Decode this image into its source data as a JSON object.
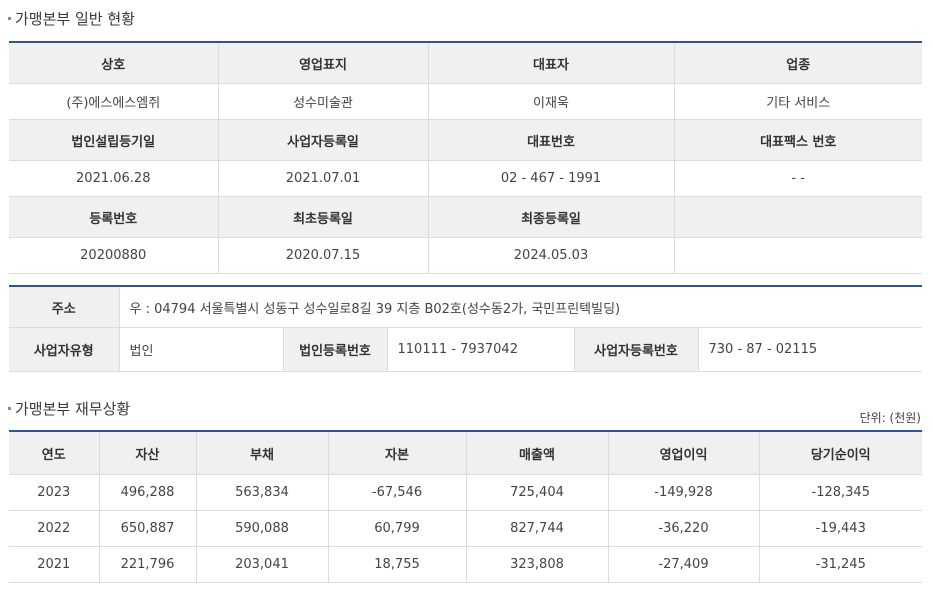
{
  "section1": {
    "title": "가맹본부 일반 현황",
    "rows": [
      {
        "headers": [
          "상호",
          "영업표지",
          "대표자",
          "업종"
        ],
        "values": [
          "(주)에스에스엠쥐",
          "성수미술관",
          "이재욱",
          "기타 서비스"
        ]
      },
      {
        "headers": [
          "법인설립등기일",
          "사업자등록일",
          "대표번호",
          "대표팩스 번호"
        ],
        "values": [
          "2021.06.28",
          "2021.07.01",
          "02 - 467 - 1991",
          "-   -"
        ]
      },
      {
        "headers": [
          "등록번호",
          "최초등록일",
          "최종등록일",
          ""
        ],
        "values": [
          "20200880",
          "2020.07.15",
          "2024.05.03",
          ""
        ]
      }
    ]
  },
  "address_block": {
    "address_label": "주소",
    "address_value": "우 : 04794 서울특별시 성동구 성수일로8길 39 지층 B02호(성수동2가, 국민프린텍빌딩)",
    "biz_type_label": "사업자유형",
    "biz_type_value": "법인",
    "corp_reg_label": "법인등록번호",
    "corp_reg_value": "110111 - 7937042",
    "biz_reg_label": "사업자등록번호",
    "biz_reg_value": "730 - 87 - 02115"
  },
  "section2": {
    "title": "가맹본부 재무상황",
    "unit": "단위: (천원)",
    "headers": [
      "연도",
      "자산",
      "부채",
      "자본",
      "매출액",
      "영업이익",
      "당기순이익"
    ],
    "rows": [
      [
        "2023",
        "496,288",
        "563,834",
        "-67,546",
        "725,404",
        "-149,928",
        "-128,345"
      ],
      [
        "2022",
        "650,887",
        "590,088",
        "60,799",
        "827,744",
        "-36,220",
        "-19,443"
      ],
      [
        "2021",
        "221,796",
        "203,041",
        "18,755",
        "323,808",
        "-27,409",
        "-31,245"
      ]
    ]
  }
}
